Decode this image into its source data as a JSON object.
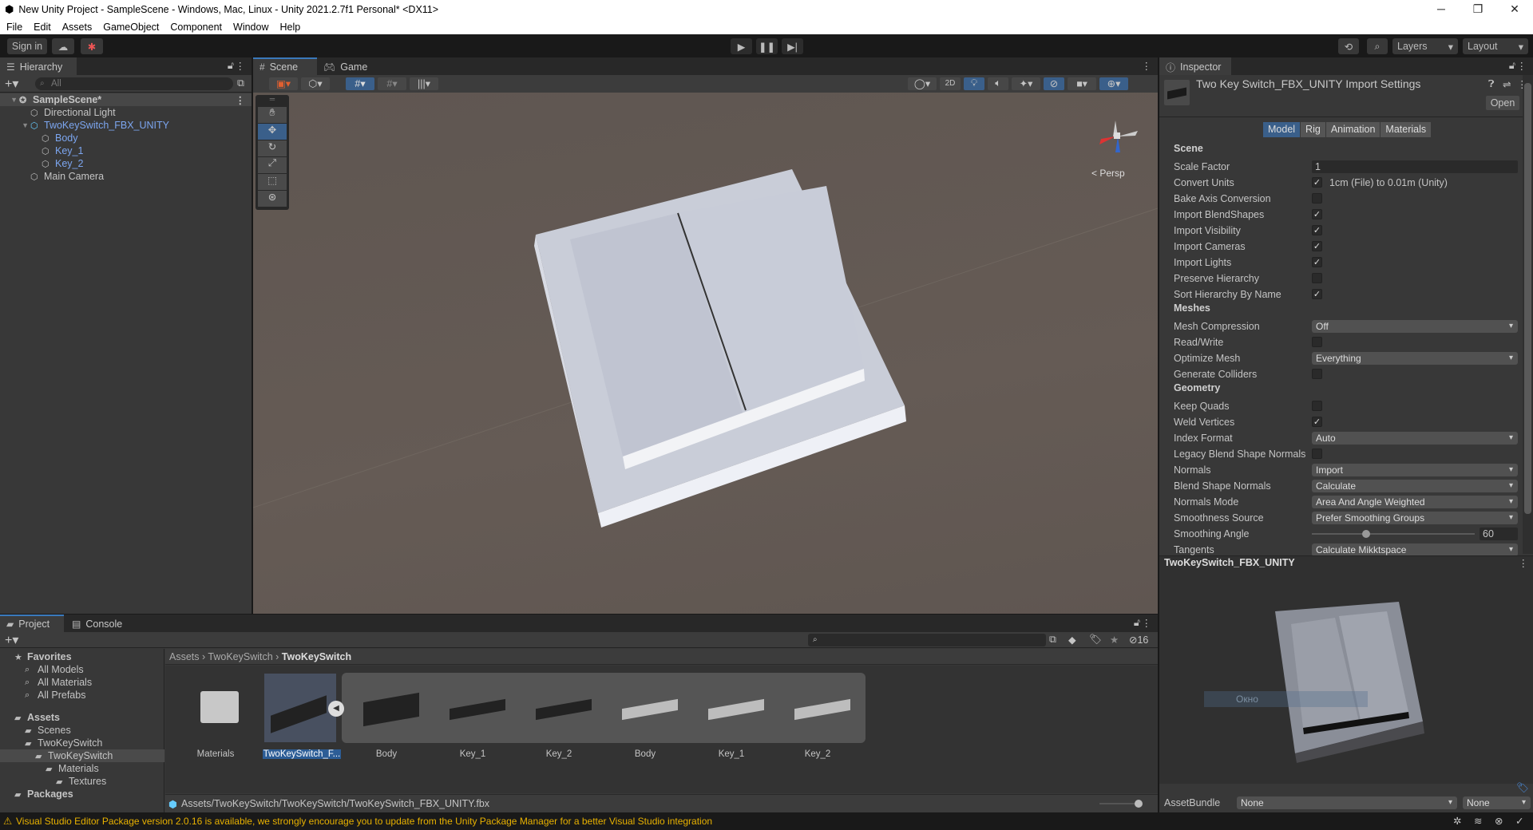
{
  "window": {
    "title": "New Unity Project - SampleScene - Windows, Mac, Linux - Unity 2021.2.7f1 Personal* <DX11>",
    "minimize": "─",
    "maximize": "❐",
    "close": "✕"
  },
  "menu": [
    "File",
    "Edit",
    "Assets",
    "GameObject",
    "Component",
    "Window",
    "Help"
  ],
  "toolbar": {
    "sign_in": "Sign in",
    "layers": "Layers",
    "layout": "Layout"
  },
  "hierarchy": {
    "tab": "Hierarchy",
    "search_placeholder": "All",
    "items": [
      {
        "label": "SampleScene*",
        "depth": 0,
        "kind": "scene",
        "expanded": true
      },
      {
        "label": "Directional Light",
        "depth": 1,
        "kind": "object"
      },
      {
        "label": "TwoKeySwitch_FBX_UNITY",
        "depth": 1,
        "kind": "prefab",
        "expanded": true
      },
      {
        "label": "Body",
        "depth": 2,
        "kind": "prefab-child"
      },
      {
        "label": "Key_1",
        "depth": 2,
        "kind": "prefab-child"
      },
      {
        "label": "Key_2",
        "depth": 2,
        "kind": "prefab-child"
      },
      {
        "label": "Main Camera",
        "depth": 1,
        "kind": "object"
      }
    ]
  },
  "scene": {
    "tabs": [
      "Scene",
      "Game"
    ],
    "btn_2d": "2D",
    "persp": "< Persp"
  },
  "inspector": {
    "tab": "Inspector",
    "title": "Two Key Switch_FBX_UNITY Import Settings",
    "open": "Open",
    "tabs": [
      "Model",
      "Rig",
      "Animation",
      "Materials"
    ],
    "active_tab": "Model",
    "rows": [
      {
        "type": "header",
        "label": "Scene"
      },
      {
        "type": "text",
        "label": "Scale Factor",
        "value": "1"
      },
      {
        "type": "check",
        "label": "Convert Units",
        "checked": true,
        "note": "1cm (File) to 0.01m (Unity)"
      },
      {
        "type": "check",
        "label": "Bake Axis Conversion",
        "checked": false
      },
      {
        "type": "check",
        "label": "Import BlendShapes",
        "checked": true
      },
      {
        "type": "check",
        "label": "Import Visibility",
        "checked": true
      },
      {
        "type": "check",
        "label": "Import Cameras",
        "checked": true
      },
      {
        "type": "check",
        "label": "Import Lights",
        "checked": true
      },
      {
        "type": "check",
        "label": "Preserve Hierarchy",
        "checked": false
      },
      {
        "type": "check",
        "label": "Sort Hierarchy By Name",
        "checked": true
      },
      {
        "type": "header",
        "label": "Meshes"
      },
      {
        "type": "dropdown",
        "label": "Mesh Compression",
        "value": "Off"
      },
      {
        "type": "check",
        "label": "Read/Write",
        "checked": false
      },
      {
        "type": "dropdown",
        "label": "Optimize Mesh",
        "value": "Everything"
      },
      {
        "type": "check",
        "label": "Generate Colliders",
        "checked": false
      },
      {
        "type": "header",
        "label": "Geometry"
      },
      {
        "type": "check",
        "label": "Keep Quads",
        "checked": false
      },
      {
        "type": "check",
        "label": "Weld Vertices",
        "checked": true
      },
      {
        "type": "dropdown",
        "label": "Index Format",
        "value": "Auto"
      },
      {
        "type": "check",
        "label": "Legacy Blend Shape Normals",
        "checked": false
      },
      {
        "type": "dropdown",
        "label": "Normals",
        "value": "Import"
      },
      {
        "type": "dropdown",
        "label": "Blend Shape Normals",
        "value": "Calculate"
      },
      {
        "type": "dropdown",
        "label": "Normals Mode",
        "value": "Area And Angle Weighted"
      },
      {
        "type": "dropdown",
        "label": "Smoothness Source",
        "value": "Prefer Smoothing Groups"
      },
      {
        "type": "slider",
        "label": "Smoothing Angle",
        "value": "60",
        "fraction": 0.333
      },
      {
        "type": "dropdown",
        "label": "Tangents",
        "value": "Calculate Mikktspace"
      }
    ],
    "preview_title": "TwoKeySwitch_FBX_UNITY",
    "preview_overlay": "Окно",
    "assetbundle_label": "AssetBundle",
    "assetbundle": "None",
    "variant": "None"
  },
  "project": {
    "tabs": [
      "Project",
      "Console"
    ],
    "hidden_count": "16",
    "tree": [
      {
        "label": "Favorites",
        "depth": 0,
        "icon": "star",
        "bold": true
      },
      {
        "label": "All Models",
        "depth": 1,
        "icon": "search"
      },
      {
        "label": "All Materials",
        "depth": 1,
        "icon": "search"
      },
      {
        "label": "All Prefabs",
        "depth": 1,
        "icon": "search"
      },
      {
        "label": "Assets",
        "depth": 0,
        "icon": "folder",
        "bold": true,
        "gap": true
      },
      {
        "label": "Scenes",
        "depth": 1,
        "icon": "folder"
      },
      {
        "label": "TwoKeySwitch",
        "depth": 1,
        "icon": "folder"
      },
      {
        "label": "TwoKeySwitch",
        "depth": 2,
        "icon": "folder",
        "selected": true
      },
      {
        "label": "Materials",
        "depth": 3,
        "icon": "folder"
      },
      {
        "label": "Textures",
        "depth": 4,
        "icon": "folder"
      },
      {
        "label": "Packages",
        "depth": 0,
        "icon": "folder",
        "bold": true
      }
    ],
    "breadcrumb": [
      "Assets",
      "TwoKeySwitch",
      "TwoKeySwitch"
    ],
    "assets": [
      "Materials",
      "TwoKeySwitch_F...",
      "Body",
      "Key_1",
      "Key_2",
      "Body",
      "Key_1",
      "Key_2"
    ],
    "path": "Assets/TwoKeySwitch/TwoKeySwitch/TwoKeySwitch_FBX_UNITY.fbx"
  },
  "status": {
    "warning": "Visual Studio Editor Package version 2.0.16 is available, we strongly encourage you to update from the Unity Package Manager for a better Visual Studio integration",
    "color": "#e8b100"
  }
}
